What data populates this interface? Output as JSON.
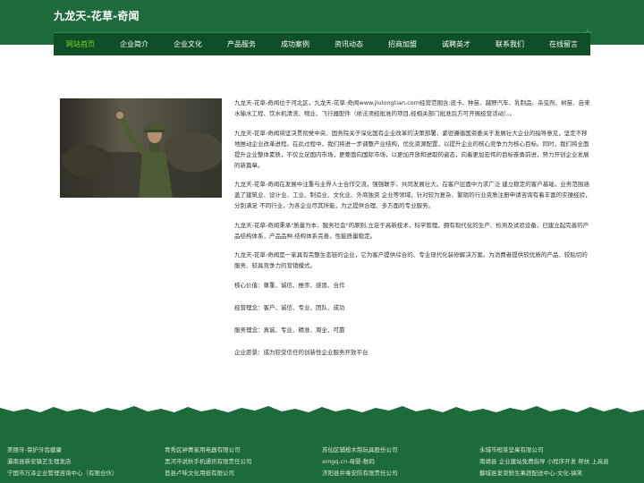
{
  "site": {
    "title": "九龙天-花草-奇闻"
  },
  "nav": {
    "items": [
      {
        "label": "网站首页",
        "active": true
      },
      {
        "label": "企业简介",
        "active": false
      },
      {
        "label": "企业文化",
        "active": false
      },
      {
        "label": "产品服务",
        "active": false
      },
      {
        "label": "成功案例",
        "active": false
      },
      {
        "label": "资讯动态",
        "active": false
      },
      {
        "label": "招商加盟",
        "active": false
      },
      {
        "label": "诚聘英才",
        "active": false
      },
      {
        "label": "联系我们",
        "active": false
      },
      {
        "label": "在线留言",
        "active": false
      }
    ]
  },
  "main": {
    "paragraphs": [
      "九龙天-花草-奇闻位于河北区，九龙天-花草-奇闻www.jiulongtian.com经营范围含:皮卡、种苗、越野汽车、乳制品、杀虫剂、树苗、自来水输水工程、饮水机清洗、物业、飞行器配件（依法须经批准的项目,经相关部门批准后方可开展经营活动）。。",
      "九龙天-花草-奇闻将坚决贯彻党中央、国务院关于深化国有企业改革的决策部署，紧密遵循国资委关于发展壮大企业的指导意见，坚定不移地推动企业改革进程。在此过程中，我们将进一步调整产业结构，优化资源配置，以提升企业的核心竞争力为核心目标。同时，我们将全面提升企业整体素质，不仅立足国内市场，更要面向国际市场，以更加开放和进取的姿态，向着更加宏伟的目标奋勇前进，努力开创企业发展的新篇章。",
      "九龙天-花草-奇闻在发展中注重与业界人士合作交流，强强联手，共同发展壮大。在客户层面中力求广泛 建立稳定的客户基础，业务范围涵盖了建筑业、设计业、工业、制造业、文化业、外商独资 企业等领域，针对较为复杂、繁琐的行业资质注册申请咨询有着丰富的实操经验，分别满足 不同行业，为各企业尽其所能，为之提供合理、多方面的专业服务。",
      "九龙天-花草-奇闻秉承\"质量为本，服务社会\"的原则,立足于高新技术，科学管理，拥有现代化的生产、检测及试验设备，已建立起完善的产品结构体系，产品品种,结构体系完善，性能质量稳定。",
      "九龙天-花草-奇闻是一家具有完整生态链的企业，它为客户提供综合的、专业现代化装修解决方案。为消费者提供较优质的产品、较贴切的服务、较具竞争力的营销模式。"
    ],
    "values": [
      "核心价值：尊重、诚信、推崇、感恩、合作",
      "经营理念：客户、诚信、专业、团队、成功",
      "服务理念：真诚、专业、精准、周全、可靠",
      "企业愿景：成为较受信任的创新性企业服务开放平台"
    ]
  },
  "footer": {
    "links": [
      "美丽牙-保护牙齿健康",
      "青秀区钟菁家用电器有限公司",
      "苏仙区辅桉木制玩具股份公司",
      "永城市桓某坚果有限公司",
      "灞南县新安镇艺生理发店",
      "黑河市说秋手机通讯有限责任公司",
      "xmgq.cn-母婴-数码",
      "南靖县 企业建站免费指导 小程序开发 帮扶 上高县",
      "宁国市万泽企业管理咨询中心（有限合伙）",
      "苜县卢味文化用纸有限公司",
      "济阳县井乘安防有限责任公司",
      "鄱城县发菜鲜生果蔬配送中心-文化-搞笑"
    ]
  },
  "colors": {
    "brand_green": "#1d6a3a",
    "nav_dark": "#0f4f27",
    "nav_active": "#7ed321"
  }
}
